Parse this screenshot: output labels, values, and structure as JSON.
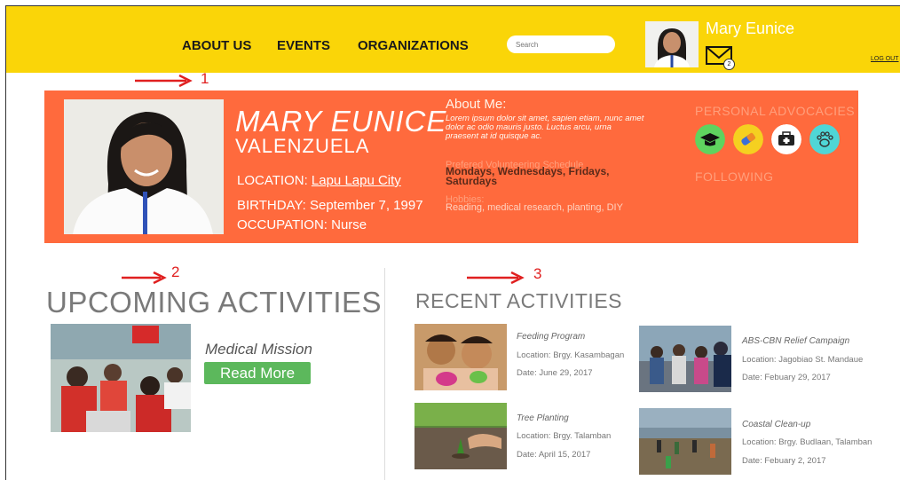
{
  "nav": {
    "about": "ABOUT US",
    "events": "EVENTS",
    "organizations": "ORGANIZATIONS",
    "search_placeholder": "Search"
  },
  "user": {
    "display_name": "Mary Eunice",
    "mail_count": "2",
    "logout": "LOG OUT"
  },
  "annotations": [
    "1",
    "2",
    "3"
  ],
  "profile": {
    "first_name": "MARY EUNICE",
    "last_name": "VALENZUELA",
    "location_label": "LOCATION: ",
    "location_value": "Lapu Lapu City",
    "birthday": "BIRTHDAY: September 7, 1997",
    "occupation": "OCCUPATION: Nurse",
    "about_heading": "About Me:",
    "about_text": "Lorem ipsum dolor sit amet, sapien etiam, nunc amet dolor ac odio mauris justo. Luctus arcu, urna praesent at id quisque ac.",
    "schedule_label": "Prefered Volunteering Schedule",
    "schedule_value": "Mondays, Wednesdays, Fridays, Saturdays",
    "hobbies_label": "Hobbies:",
    "hobbies_value": "Reading, medical research, planting, DIY",
    "advocacies_heading": "PERSONAL ADVOCACIES",
    "following_heading": "FOLLOWING",
    "advocacy_icons": [
      {
        "name": "education-icon",
        "color": "#5fd35f"
      },
      {
        "name": "health-icon",
        "color": "#f5d020"
      },
      {
        "name": "medical-kit-icon",
        "color": "#ffffff"
      },
      {
        "name": "animal-welfare-icon",
        "color": "#4fd6d6"
      }
    ]
  },
  "upcoming": {
    "title": "UPCOMING ACTIVITIES",
    "item_title": "Medical Mission",
    "read_more": "Read More"
  },
  "recent": {
    "title": "RECENT ACTIVITIES",
    "items": [
      {
        "title": "Feeding Program",
        "location": "Location: Brgy. Kasambagan",
        "date": "Date: June 29, 2017"
      },
      {
        "title": "ABS-CBN Relief Campaign",
        "location": "Location: Jagobiao St. Mandaue",
        "date": "Date:  Febuary 29, 2017"
      },
      {
        "title": "Tree Planting",
        "location": "Location: Brgy. Talamban",
        "date": "Date: April 15, 2017"
      },
      {
        "title": "Coastal Clean-up",
        "location": "Location: Brgy. Budlaan, Talamban",
        "date": "Date:  Febuary 2, 2017"
      }
    ]
  }
}
